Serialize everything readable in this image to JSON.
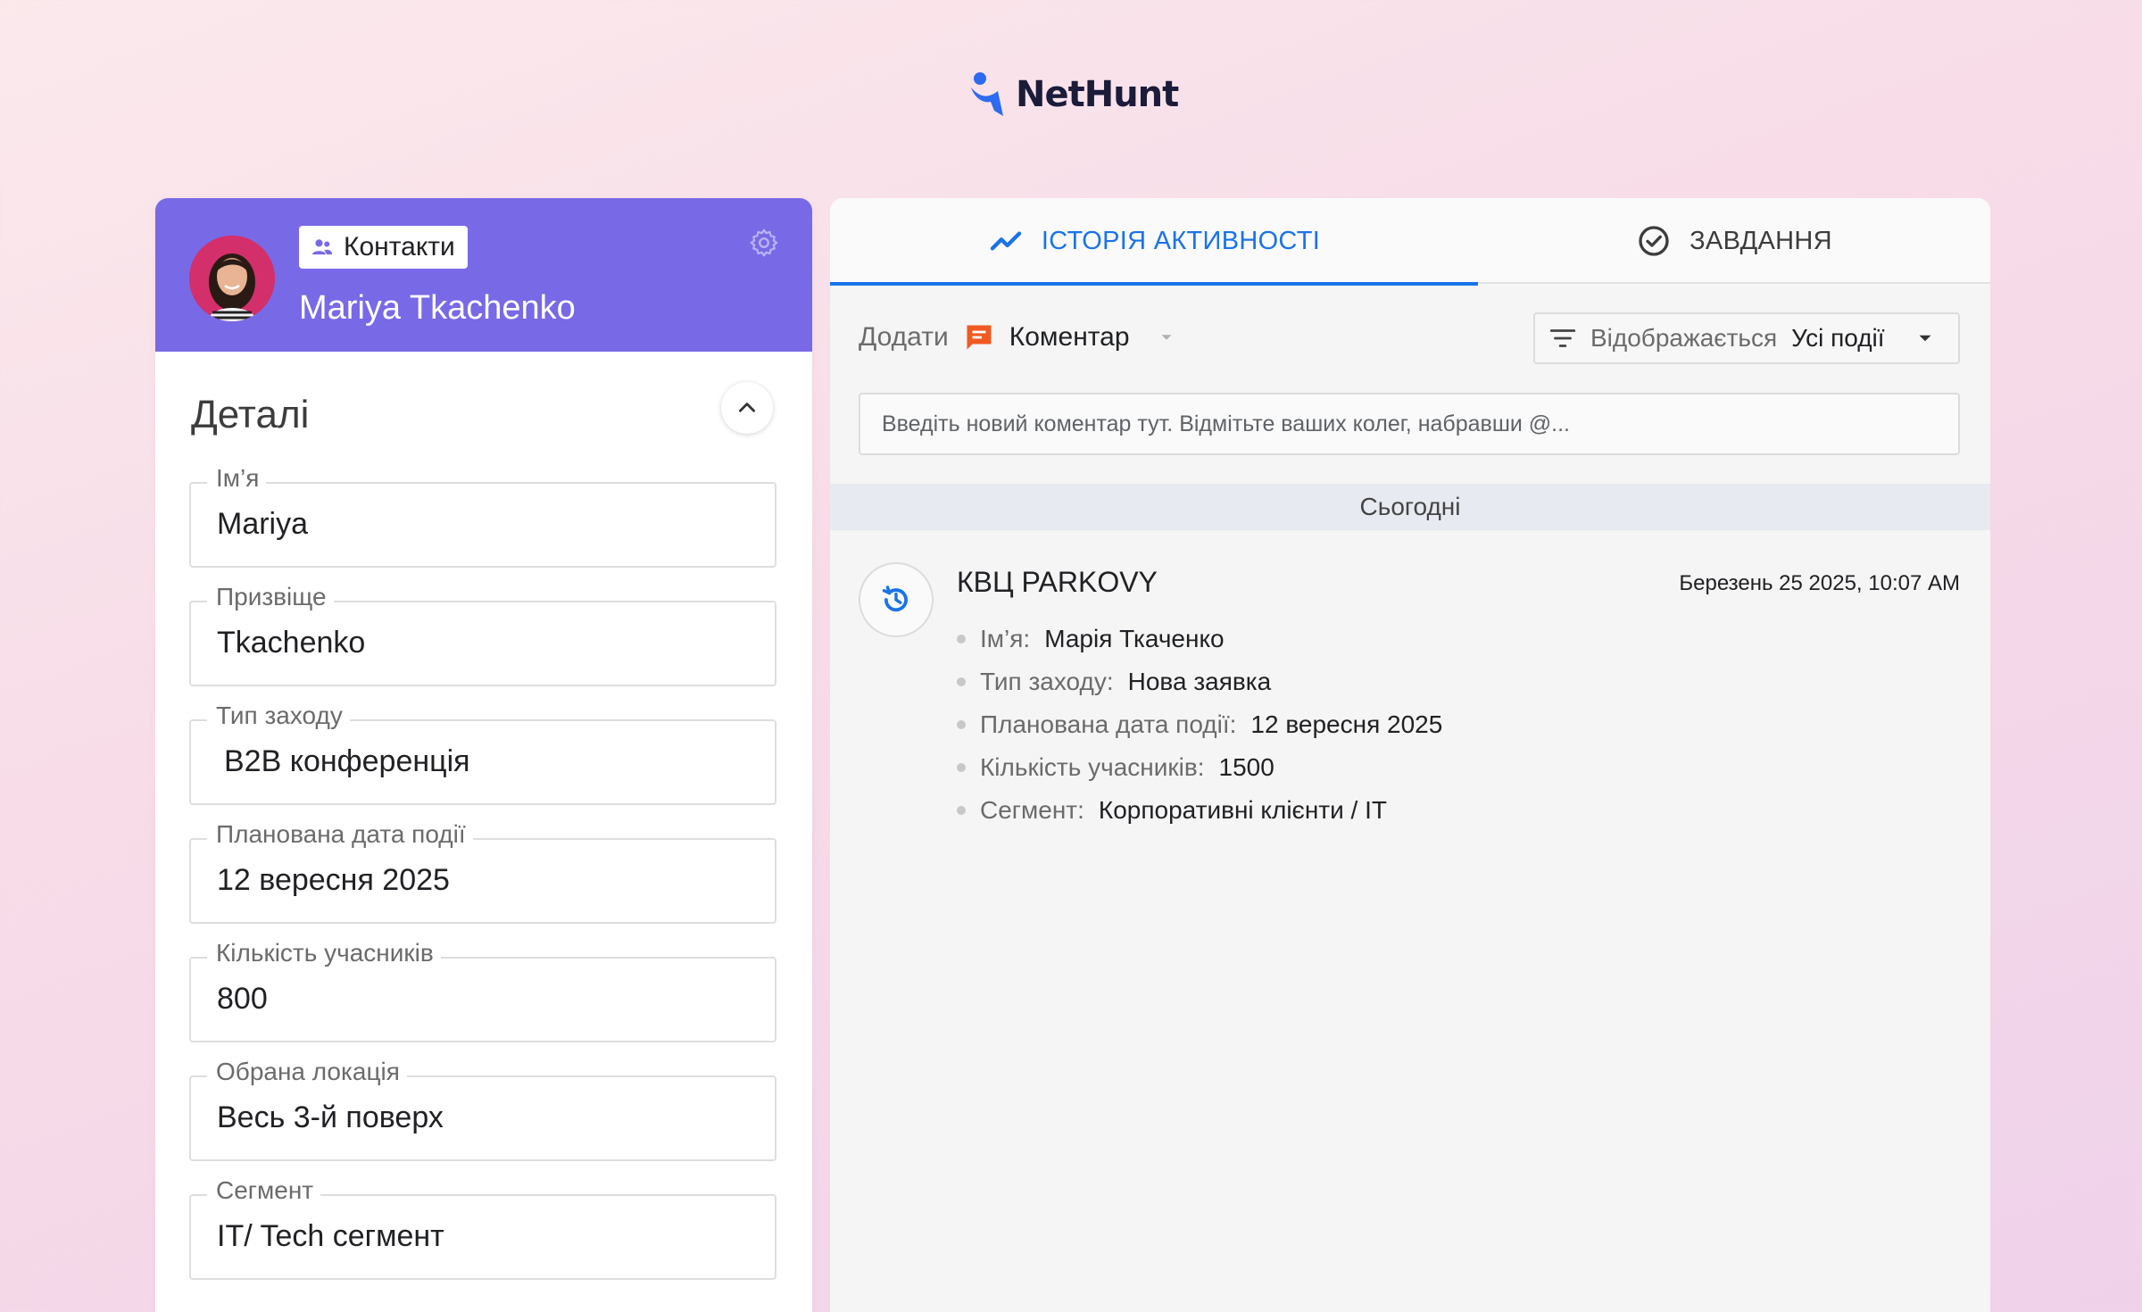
{
  "brand": {
    "name": "NetHunt",
    "accent": "#1a73e8",
    "header_color": "#7869e6"
  },
  "contact": {
    "section_chip": "Контакти",
    "name": "Mariya Tkachenko",
    "avatar": "avatar-photo"
  },
  "details": {
    "heading": "Деталі",
    "fields": [
      {
        "label": "Ім’я",
        "value": "Mariya"
      },
      {
        "label": "Призвіще",
        "value": "Tkachenko"
      },
      {
        "label": "Тип заходу",
        "value": "B2B конференція"
      },
      {
        "label": "Планована дата події",
        "value": "12 вересня 2025"
      },
      {
        "label": "Кількість учасників",
        "value": "800"
      },
      {
        "label": "Обрана локація",
        "value": "Весь 3-й поверх"
      },
      {
        "label": "Сегмент",
        "value": "IT/ Tech сегмент"
      }
    ]
  },
  "tabs": {
    "activity": "ІСТОРІЯ АКТИВНОСТІ",
    "tasks": "ЗАВДАННЯ"
  },
  "composer": {
    "add_label": "Додати",
    "add_type": "Коментар",
    "filter_label": "Відображається",
    "filter_value": "Усі події",
    "comment_placeholder": "Введіть новий коментар тут. Відмітьте ваших колег, набравши @..."
  },
  "timeline": {
    "day": "Сьогодні",
    "event": {
      "title": "КВЦ PARKOVY",
      "date": "Березень 25 2025, 10:07 AM",
      "items": [
        {
          "key": "Ім’я:",
          "value": "Марія Ткаченко"
        },
        {
          "key": "Тип заходу:",
          "value": "Нова заявка"
        },
        {
          "key": "Планована дата події:",
          "value": "12 вересня 2025"
        },
        {
          "key": "Кількість учасників:",
          "value": "1500"
        },
        {
          "key": "Сегмент:",
          "value": "Корпоративні клієнти / IT"
        }
      ]
    }
  }
}
